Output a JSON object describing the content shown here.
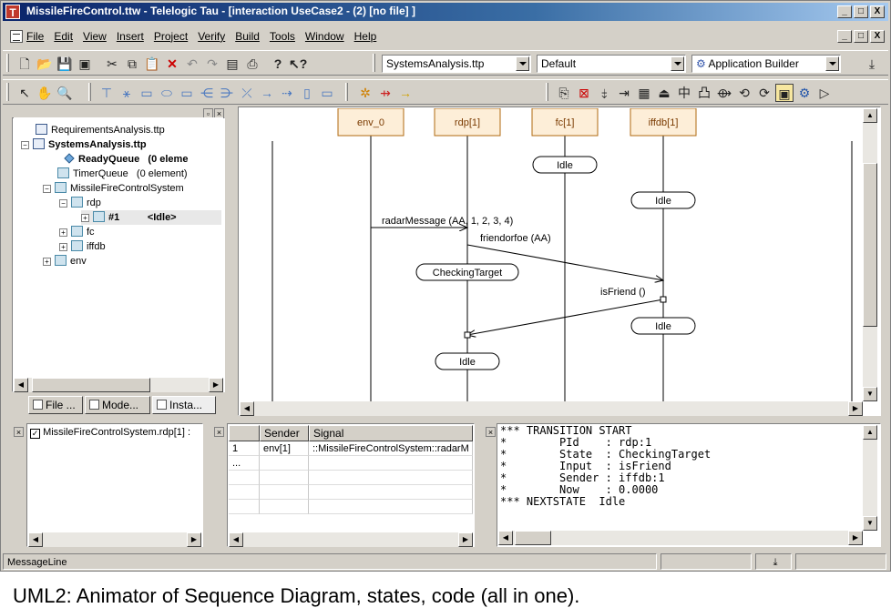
{
  "window": {
    "title": "MissileFireControl.ttw - Telelogic Tau - [interaction UseCase2 - (2) [no file] ]",
    "app_icon": "T"
  },
  "caption_buttons": {
    "minimize": "_",
    "restore": "□",
    "close": "X"
  },
  "menu": [
    "File",
    "Edit",
    "View",
    "Insert",
    "Project",
    "Verify",
    "Build",
    "Tools",
    "Window",
    "Help"
  ],
  "toolbar": {
    "project_combo": "SystemsAnalysis.ttp",
    "config_combo": "Default",
    "builder_combo": "Application Builder"
  },
  "tree": {
    "items": [
      {
        "label": "RequirementsAnalysis.ttp",
        "bold": false
      },
      {
        "label": "SystemsAnalysis.ttp",
        "bold": true
      },
      {
        "label": "ReadyQueue",
        "extra": "(0 eleme",
        "bold": true
      },
      {
        "label": "TimerQueue",
        "extra": "(0 element)",
        "bold": false
      },
      {
        "label": "MissileFireControlSystem",
        "bold": false
      },
      {
        "label": "rdp",
        "bold": false
      },
      {
        "label": "#1",
        "extra": "<Idle>",
        "bold": true
      },
      {
        "label": "fc",
        "bold": false
      },
      {
        "label": "iffdb",
        "bold": false
      },
      {
        "label": "env",
        "bold": false
      }
    ]
  },
  "tabs": [
    "File ...",
    "Mode...",
    "Insta..."
  ],
  "diagram": {
    "lifelines": [
      {
        "name": "env_0"
      },
      {
        "name": "rdp[1]"
      },
      {
        "name": "fc[1]"
      },
      {
        "name": "iffdb[1]"
      }
    ],
    "states": [
      "Idle",
      "Idle",
      "CheckingTarget",
      "Idle",
      "Idle"
    ],
    "messages": [
      {
        "label": "radarMessage (AA, 1, 2, 3, 4)"
      },
      {
        "label": "friendorfoe (AA)"
      },
      {
        "label": "isFriend ()"
      }
    ]
  },
  "watch": {
    "label": "MissileFireControlSystem.rdp[1] :"
  },
  "signal_log": {
    "columns": [
      "",
      "Sender",
      "Signal"
    ],
    "rows": [
      [
        "1",
        "env[1]",
        "::MissileFireControlSystem::radarM"
      ],
      [
        "...",
        "",
        ""
      ]
    ]
  },
  "trace_text": "*** TRANSITION START\n*        PId    : rdp:1\n*        State  : CheckingTarget\n*        Input  : isFriend\n*        Sender : iffdb:1\n*        Now    : 0.0000\n*** NEXTSTATE  Idle",
  "statusbar": {
    "message": "MessageLine"
  },
  "caption": "UML2: Animator of Sequence Diagram, states, code (all in one).",
  "colors": {
    "lifeline_box": "#fdeed8",
    "lifeline_border": "#b06a10",
    "state_fill": "#ffffff",
    "titlebar": "#0a246a"
  }
}
